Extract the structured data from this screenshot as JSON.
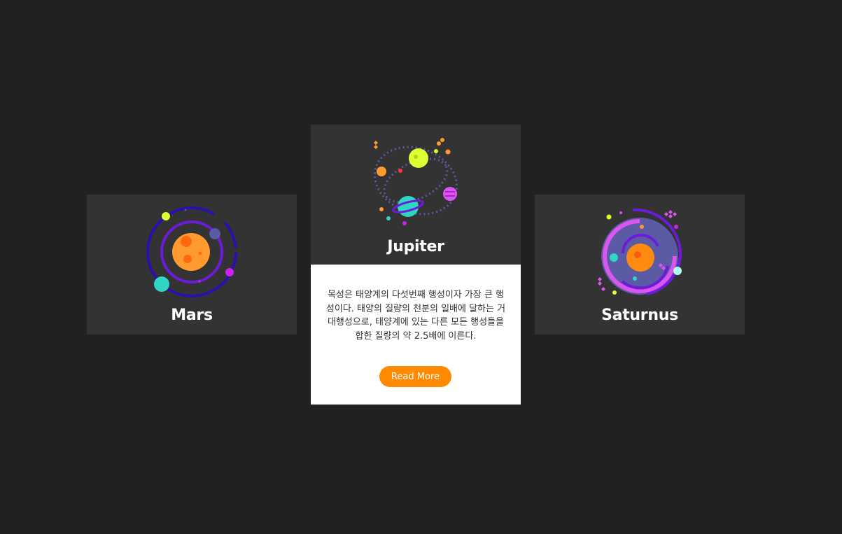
{
  "cards": [
    {
      "title": "Mars",
      "icon": "orbit-planet-icon"
    },
    {
      "title": "Jupiter",
      "icon": "planetary-system-icon",
      "description": "목성은 태양계의 다섯번째 행성이자 가장 큰 행성이다. 태양의 질량의 천분의 일배에 달하는 거대행성으로, 태양계에 있는 다른 모든 행성들을 합한 질량의 약 2.5배에 이른다.",
      "button_label": "Read More"
    },
    {
      "title": "Saturnus",
      "icon": "galaxy-swirl-icon"
    }
  ],
  "colors": {
    "page_background": "#212121",
    "card_background": "#333333",
    "detail_background": "#ffffff",
    "accent": "#ff8a00"
  }
}
